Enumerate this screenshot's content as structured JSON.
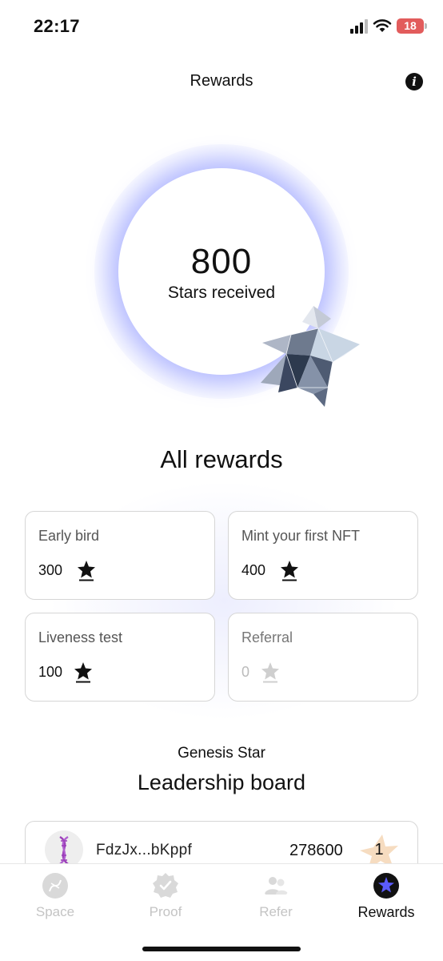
{
  "status_bar": {
    "time": "22:17",
    "battery": "18"
  },
  "header": {
    "title": "Rewards",
    "info_icon": "info-icon"
  },
  "hero": {
    "value": "800",
    "label": "Stars received",
    "icon": "crystal-star-icon"
  },
  "rewards": {
    "title": "All rewards",
    "cards": [
      {
        "title": "Early bird",
        "value": "300",
        "icon": "star-icon",
        "enabled": true
      },
      {
        "title": "Mint your first NFT",
        "value": "400",
        "icon": "star-icon",
        "enabled": true
      },
      {
        "title": "Liveness test",
        "value": "100",
        "icon": "star-icon",
        "enabled": true
      },
      {
        "title": "Referral",
        "value": "0",
        "icon": "star-icon",
        "enabled": false
      }
    ]
  },
  "leaderboard": {
    "subtitle": "Genesis Star",
    "title": "Leadership board",
    "rows": [
      {
        "address": "FdzJx...bKppf",
        "score": "278600",
        "rank": "1",
        "avatar": "dna-icon"
      }
    ]
  },
  "tabs": [
    {
      "label": "Space",
      "icon": "dna-icon",
      "active": false
    },
    {
      "label": "Proof",
      "icon": "badge-check-icon",
      "active": false
    },
    {
      "label": "Refer",
      "icon": "people-icon",
      "active": false
    },
    {
      "label": "Rewards",
      "icon": "star-icon",
      "active": true
    }
  ],
  "colors": {
    "accent_glow": "#8c96ff",
    "active_tab_icon": "#111111",
    "star_icon_active": "#5b5bff",
    "rank_star": "#f6dcc0"
  }
}
